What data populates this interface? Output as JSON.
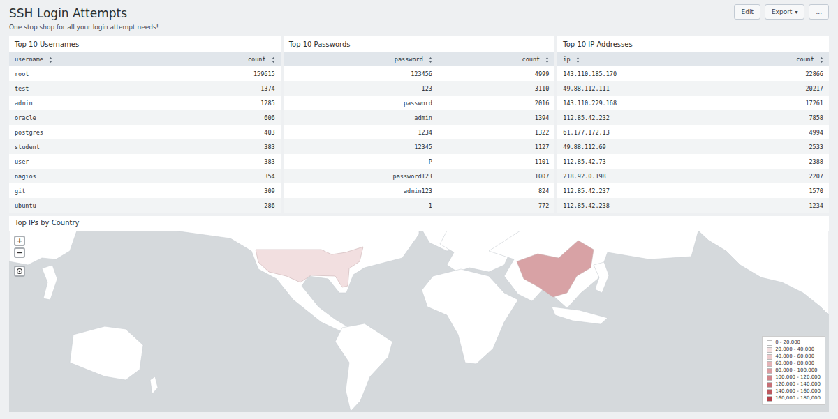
{
  "dashboard": {
    "title": "SSH Login Attempts",
    "subtitle": "One stop shop for all your login attempt needs!"
  },
  "buttons": [
    {
      "label": "Edit",
      "caret": ""
    },
    {
      "label": "Export",
      "caret": "▾"
    },
    {
      "label": "...",
      "caret": ""
    }
  ],
  "tables": [
    {
      "title": "Top 10 Usernames",
      "columns": [
        {
          "label": "username",
          "kind": "label"
        },
        {
          "label": "count",
          "kind": "value"
        }
      ],
      "rows": [
        [
          "root",
          "159615"
        ],
        [
          "test",
          "1374"
        ],
        [
          "admin",
          "1285"
        ],
        [
          "oracle",
          "606"
        ],
        [
          "postgres",
          "403"
        ],
        [
          "student",
          "383"
        ],
        [
          "user",
          "383"
        ],
        [
          "nagios",
          "354"
        ],
        [
          "git",
          "309"
        ],
        [
          "ubuntu",
          "286"
        ]
      ]
    },
    {
      "title": "Top 10 Passwords",
      "columns": [
        {
          "label": "password",
          "kind": "value"
        },
        {
          "label": "count",
          "kind": "value"
        }
      ],
      "rows": [
        [
          "123456",
          "4999"
        ],
        [
          "123",
          "3110"
        ],
        [
          "password",
          "2016"
        ],
        [
          "admin",
          "1394"
        ],
        [
          "1234",
          "1322"
        ],
        [
          "12345",
          "1127"
        ],
        [
          "P",
          "1101"
        ],
        [
          "password123",
          "1007"
        ],
        [
          "admin123",
          "824"
        ],
        [
          "1",
          "772"
        ]
      ]
    },
    {
      "title": "Top 10 IP Addresses",
      "columns": [
        {
          "label": "ip",
          "kind": "label"
        },
        {
          "label": "count",
          "kind": "value"
        }
      ],
      "rows": [
        [
          "143.110.185.170",
          "22866"
        ],
        [
          "49.88.112.111",
          "20217"
        ],
        [
          "143.110.229.168",
          "17261"
        ],
        [
          "112.85.42.232",
          "7858"
        ],
        [
          "61.177.172.13",
          "4994"
        ],
        [
          "49.88.112.69",
          "2533"
        ],
        [
          "112.85.42.73",
          "2388"
        ],
        [
          "218.92.0.198",
          "2207"
        ],
        [
          "112.85.42.237",
          "1570"
        ],
        [
          "112.85.42.238",
          "1234"
        ]
      ]
    }
  ],
  "map": {
    "title": "Top IPs by Country",
    "zoom": {
      "in": "+",
      "out": "−"
    },
    "regions": [
      {
        "country": "United States",
        "color": "#f2dfe0"
      },
      {
        "country": "China",
        "color": "#d8a2a5"
      }
    ],
    "legend": [
      {
        "label": "0 - 20,000",
        "color": "#ffffff"
      },
      {
        "label": "20,000 - 40,000",
        "color": "#f5e1e2"
      },
      {
        "label": "40,000 - 60,000",
        "color": "#eccacc"
      },
      {
        "label": "60,000 - 80,000",
        "color": "#e3b3b6"
      },
      {
        "label": "80,000 - 100,000",
        "color": "#d99ca0"
      },
      {
        "label": "100,000 - 120,000",
        "color": "#d0868b"
      },
      {
        "label": "120,000 - 140,000",
        "color": "#c66f75"
      },
      {
        "label": "140,000 - 160,000",
        "color": "#bd595f"
      },
      {
        "label": "160,000 - 180,000",
        "color": "#b3424a"
      }
    ]
  }
}
